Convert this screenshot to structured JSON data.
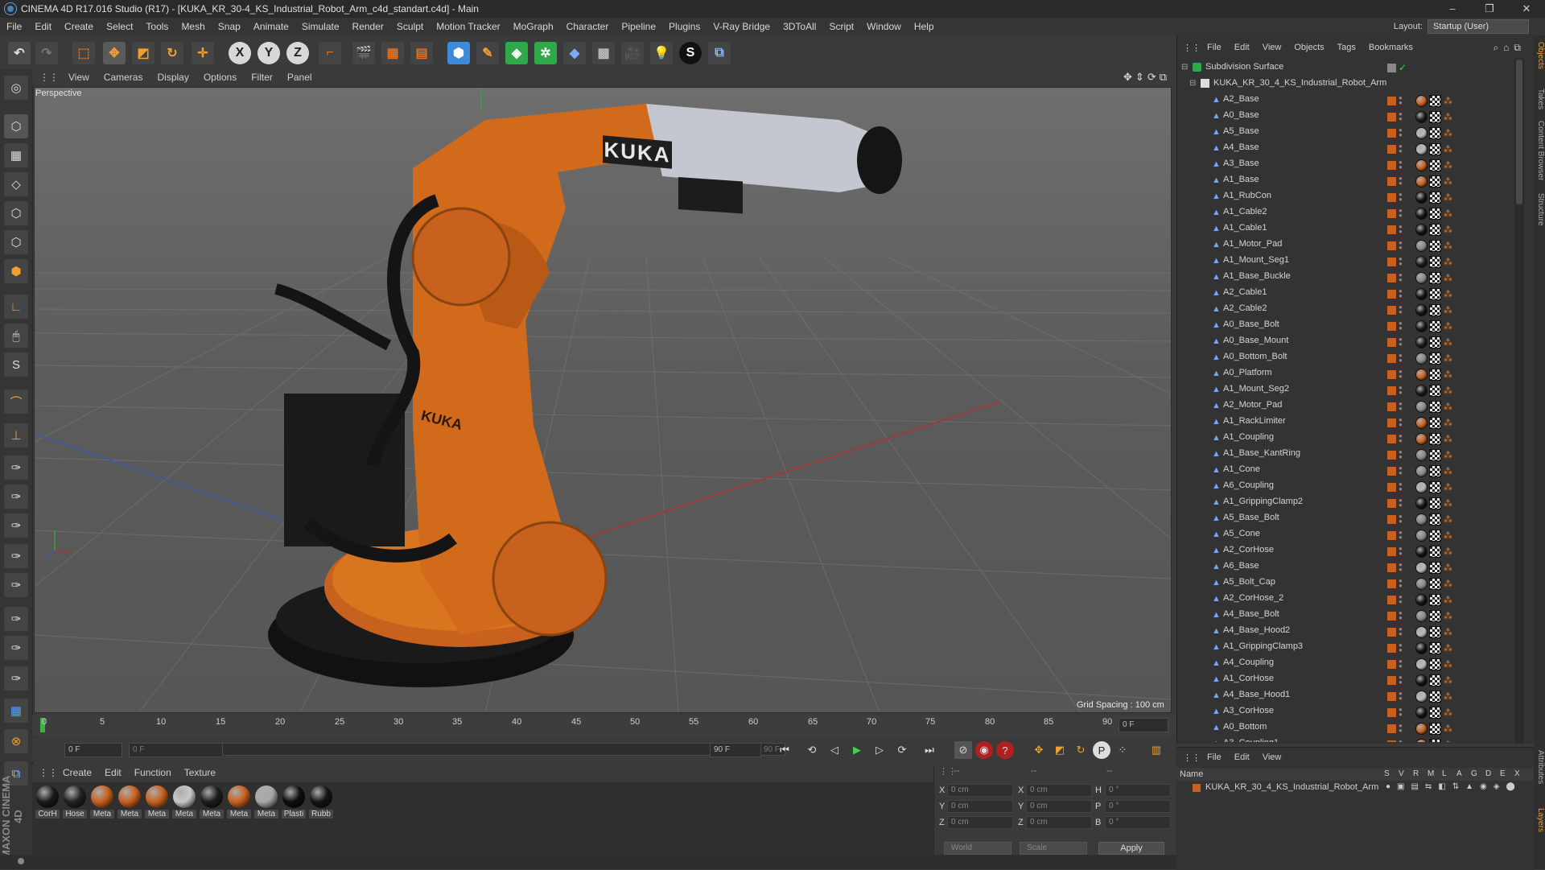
{
  "window": {
    "title": "CINEMA 4D R17.016 Studio (R17) - [KUKA_KR_30-4_KS_Industrial_Robot_Arm_c4d_standart.c4d] - Main",
    "buttons": [
      "–",
      "❐",
      "✕"
    ]
  },
  "menu": [
    "File",
    "Edit",
    "Create",
    "Select",
    "Tools",
    "Mesh",
    "Snap",
    "Animate",
    "Simulate",
    "Render",
    "Sculpt",
    "Motion Tracker",
    "MoGraph",
    "Character",
    "Pipeline",
    "Plugins",
    "V-Ray Bridge",
    "3DToAll",
    "Script",
    "Window",
    "Help"
  ],
  "layout": {
    "label": "Layout:",
    "value": "Startup (User)"
  },
  "toolbar": {
    "axis_x": "X",
    "axis_y": "Y",
    "axis_z": "Z"
  },
  "viewport": {
    "menu": [
      "View",
      "Cameras",
      "Display",
      "Options",
      "Filter",
      "Panel"
    ],
    "camera_label": "Perspective",
    "grid_spacing": "Grid Spacing : 100 cm",
    "logo_text": "KUKA"
  },
  "timeline": {
    "ticks": [
      "0",
      "5",
      "10",
      "15",
      "20",
      "25",
      "30",
      "35",
      "40",
      "45",
      "50",
      "55",
      "60",
      "65",
      "70",
      "75",
      "80",
      "85",
      "90"
    ],
    "current_frame": "0 F"
  },
  "transport": {
    "start_field": "0 F",
    "range_start": "0 F",
    "range_end": "90 F",
    "end_field": "90 F"
  },
  "materials": {
    "menu": [
      "Create",
      "Edit",
      "Function",
      "Texture"
    ],
    "items": [
      {
        "label": "CorH",
        "color": "#1a1a1a"
      },
      {
        "label": "Hose",
        "color": "#222222"
      },
      {
        "label": "Meta",
        "color": "#c8601e"
      },
      {
        "label": "Meta",
        "color": "#c8601e"
      },
      {
        "label": "Meta",
        "color": "#c8601e"
      },
      {
        "label": "Meta",
        "color": "#c9c9c9"
      },
      {
        "label": "Meta",
        "color": "#1d1d1d"
      },
      {
        "label": "Meta",
        "color": "#c8601e"
      },
      {
        "label": "Meta",
        "color": "#a8a8a8"
      },
      {
        "label": "Plasti",
        "color": "#0e0e0e"
      },
      {
        "label": "Rubb",
        "color": "#151515"
      }
    ]
  },
  "coordinates": {
    "rows": [
      {
        "a": "X",
        "av": "0 cm",
        "b": "X",
        "bv": "0 cm",
        "c": "H",
        "cv": "0 °"
      },
      {
        "a": "Y",
        "av": "0 cm",
        "b": "Y",
        "bv": "0 cm",
        "c": "P",
        "cv": "0 °"
      },
      {
        "a": "Z",
        "av": "0 cm",
        "b": "Z",
        "bv": "0 cm",
        "c": "B",
        "cv": "0 °"
      }
    ],
    "col_headers": [
      "--",
      "--",
      "--"
    ],
    "mode": "World",
    "scale": "Scale",
    "apply": "Apply"
  },
  "object_manager": {
    "menu": [
      "File",
      "Edit",
      "View",
      "Objects",
      "Tags",
      "Bookmarks"
    ],
    "root": "Subdivision Surface",
    "group": "KUKA_KR_30_4_KS_Industrial_Robot_Arm",
    "objects": [
      {
        "name": "A2_Base",
        "ball": "#c8601e"
      },
      {
        "name": "A0_Base",
        "ball": "#1a1a1a"
      },
      {
        "name": "A5_Base",
        "ball": "#b8b8b8"
      },
      {
        "name": "A4_Base",
        "ball": "#b8b8b8"
      },
      {
        "name": "A3_Base",
        "ball": "#c8601e"
      },
      {
        "name": "A1_Base",
        "ball": "#c8601e"
      },
      {
        "name": "A1_RubCon",
        "ball": "#151515"
      },
      {
        "name": "A1_Cable2",
        "ball": "#151515"
      },
      {
        "name": "A1_Cable1",
        "ball": "#151515"
      },
      {
        "name": "A1_Motor_Pad",
        "ball": "#888888"
      },
      {
        "name": "A1_Mount_Seg1",
        "ball": "#1a1a1a"
      },
      {
        "name": "A1_Base_Buckle",
        "ball": "#888888"
      },
      {
        "name": "A2_Cable1",
        "ball": "#151515"
      },
      {
        "name": "A2_Cable2",
        "ball": "#151515"
      },
      {
        "name": "A0_Base_Bolt",
        "ball": "#1a1a1a"
      },
      {
        "name": "A0_Base_Mount",
        "ball": "#1a1a1a"
      },
      {
        "name": "A0_Bottom_Bolt",
        "ball": "#888888"
      },
      {
        "name": "A0_Platform",
        "ball": "#c8601e"
      },
      {
        "name": "A1_Mount_Seg2",
        "ball": "#1a1a1a"
      },
      {
        "name": "A2_Motor_Pad",
        "ball": "#888888"
      },
      {
        "name": "A1_RackLimiter",
        "ball": "#c8601e"
      },
      {
        "name": "A1_Coupling",
        "ball": "#c8601e"
      },
      {
        "name": "A1_Base_KantRing",
        "ball": "#888888"
      },
      {
        "name": "A1_Cone",
        "ball": "#888888"
      },
      {
        "name": "A6_Coupling",
        "ball": "#b8b8b8"
      },
      {
        "name": "A1_GrippingClamp2",
        "ball": "#151515"
      },
      {
        "name": "A5_Base_Bolt",
        "ball": "#888888"
      },
      {
        "name": "A5_Cone",
        "ball": "#888888"
      },
      {
        "name": "A2_CorHose",
        "ball": "#151515"
      },
      {
        "name": "A6_Base",
        "ball": "#b8b8b8"
      },
      {
        "name": "A5_Bolt_Cap",
        "ball": "#888888"
      },
      {
        "name": "A2_CorHose_2",
        "ball": "#151515"
      },
      {
        "name": "A4_Base_Bolt",
        "ball": "#888888"
      },
      {
        "name": "A4_Base_Hood2",
        "ball": "#b8b8b8"
      },
      {
        "name": "A1_GrippingClamp3",
        "ball": "#151515"
      },
      {
        "name": "A4_Coupling",
        "ball": "#b8b8b8"
      },
      {
        "name": "A1_CorHose",
        "ball": "#151515"
      },
      {
        "name": "A4_Base_Hood1",
        "ball": "#b8b8b8"
      },
      {
        "name": "A3_CorHose",
        "ball": "#151515"
      },
      {
        "name": "A0_Bottom",
        "ball": "#c8601e"
      },
      {
        "name": "A3_Coupling1",
        "ball": "#c8601e"
      }
    ]
  },
  "layer_manager": {
    "menu": [
      "File",
      "Edit",
      "View"
    ],
    "columns": {
      "name": "Name",
      "flags": [
        "S",
        "V",
        "R",
        "M",
        "L",
        "A",
        "G",
        "D",
        "E",
        "X"
      ]
    },
    "row": "KUKA_KR_30_4_KS_Industrial_Robot_Arm"
  },
  "side_tabs": [
    "Objects",
    "Takes",
    "Content Browser",
    "Structure",
    "Attributes",
    "Layers"
  ],
  "colors": {
    "accent_orange": "#c8601e",
    "selection_blue": "#3d6ea5"
  }
}
